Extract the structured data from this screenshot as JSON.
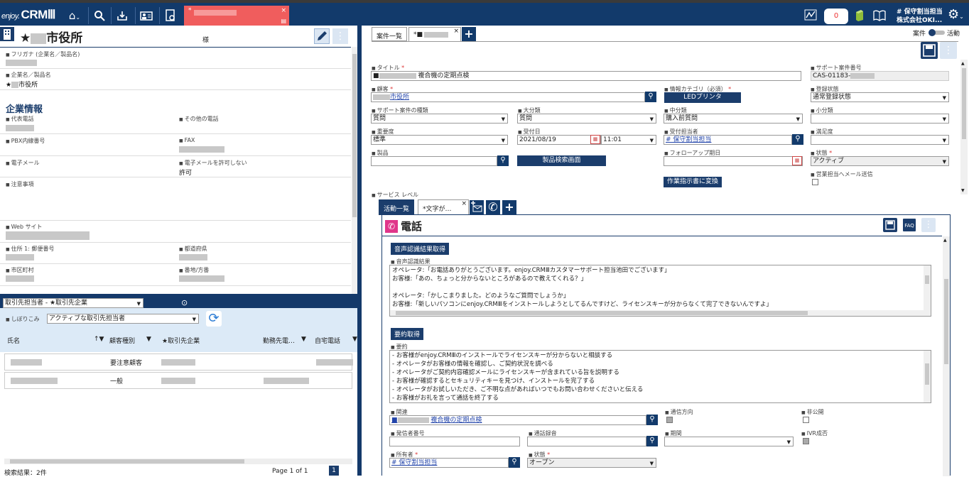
{
  "topbar": {
    "logo_prefix": "enjoy.",
    "logo_main": "CRMⅢ",
    "home_icon": "⌂",
    "search_icon": "⚲",
    "active_tab_prefix": "*",
    "active_tab_close": "×",
    "notification_count": "0",
    "user_line1": "# 保守割当担当",
    "user_line2": "株式会社OKI..."
  },
  "left": {
    "title_star": "★",
    "title_suffix": "市役所",
    "honorific": "様",
    "furigana_label": "フリガナ (企業名／製品名)",
    "company_label": "企業名／製品名",
    "company_value_star": "★",
    "company_value_suffix": "市役所",
    "section_title": "企業情報",
    "phone_label": "代表電話",
    "other_phone_label": "その他の電話",
    "pbx_label": "PBX内線番号",
    "fax_label": "FAX",
    "email_label": "電子メール",
    "email_allow_label": "電子メールを許可しない",
    "email_allow_value": "許可",
    "notes_label": "注意事項",
    "website_label": "Web サイト",
    "address_label": "住所 1: 郵便番号",
    "prefecture_label": "都道府県",
    "city_label": "市区町村",
    "street_label": "番地/方番"
  },
  "lower_left": {
    "view_select": "取引先担当者 - ★取引先企業",
    "filter_label": "しぼりこみ",
    "filter_select": "アクティブな取引先担当者",
    "columns": [
      "氏名",
      "顧客種別",
      "★取引先企業",
      "勤務先電…",
      "自宅電話"
    ],
    "sort_icon": "↑▼",
    "filter_icon": "▼",
    "rows": [
      {
        "type": "要注意顧客"
      },
      {
        "type": "一般"
      }
    ],
    "result_count": "検索結果：2件",
    "pager": "Page 1 of 1",
    "page_num": "1"
  },
  "right": {
    "tab_list": "案件一覧",
    "tab_active": "*■",
    "tab_close": "×",
    "toggle_left": "案件",
    "toggle_right": "活動",
    "title_label": "タイトル",
    "title_value_prefix": "■",
    "title_value": "複合機の定期点検",
    "support_no_label": "サポート案件番号",
    "support_no_value": "CAS-01183-",
    "customer_label": "顧客",
    "customer_value": "市役所",
    "category_label": "情報カテゴリ（必須）",
    "category_value": "LEDプリンタ",
    "reg_status_label": "登録状態",
    "reg_status_value": "通常登録状態",
    "case_type_label": "サポート案件の種類",
    "case_type_value": "質問",
    "major_label": "大分類",
    "major_value": "質問",
    "middle_label": "中分類",
    "middle_value": "購入前質問",
    "minor_label": "小分類",
    "priority_label": "重要度",
    "priority_value": "標準",
    "date_label": "受付日",
    "date_value": "2021/08/19",
    "time_value": "11:01",
    "receiver_label": "受付担当者",
    "receiver_value": "# 保守割当担当",
    "satisfaction_label": "満足度",
    "product_label": "製品",
    "product_search_btn": "製品検索画面",
    "followup_label": "フォローアップ期日",
    "state_label": "状態",
    "state_value": "アクティブ",
    "sales_mail_label": "営業担当へメール送信",
    "work_order_btn": "作業指示書に変換",
    "service_level_label": "サービス レベル"
  },
  "activity": {
    "tab_list": "活動一覧",
    "tab_active": "*文字が…",
    "tab_close": "×",
    "header": "電話",
    "faq": "FAQ",
    "voice_btn": "音声認識結果取得",
    "voice_label": "音声認識結果",
    "transcript": [
      "オペレータ:「お電話ありがとうございます。enjoy.CRMⅢカスタマーサポート担当池田でございます」",
      "お客様:「あの、ちょっと分からないところがあるので教えてくれる？」",
      "",
      "オペレータ:「かしこまりました。どのようなご質問でしょうか」",
      "お客様:「新しいパソコンにenjoy.CRMⅢをインストールしようとしてるんですけど、ライセンスキーが分からなくて完了できないんですよ」"
    ],
    "summary_btn": "要約取得",
    "summary_label": "要約",
    "summary": [
      "- お客様がenjoy.CRMⅢのインストールでライセンスキーが分からないと相談する",
      "- オペレータがお客様の情報を確認し、ご契約状況を調べる",
      "- オペレータがご契約内容確認メールにライセンスキーが含まれている旨を説明する",
      "- お客様が確認するとセキュリティキーを見つけ、インストールを完了する",
      "- オペレータがお試しいただき、ご不明な点があればいつでもお問い合わせくださいと伝える",
      "- お客様がお礼を言って通話を終了する"
    ],
    "related_label": "関連",
    "related_value_prefix": "■",
    "related_value": "複合機の定期点検",
    "direction_label": "通信方向",
    "private_label": "非公開",
    "caller_label": "発信者番号",
    "recording_label": "通話録音",
    "period_label": "期間",
    "ivr_label": "IVR成否",
    "owner_label": "所有者",
    "owner_value": "# 保守割当担当",
    "status_label": "状態",
    "status_value": "オープン"
  }
}
